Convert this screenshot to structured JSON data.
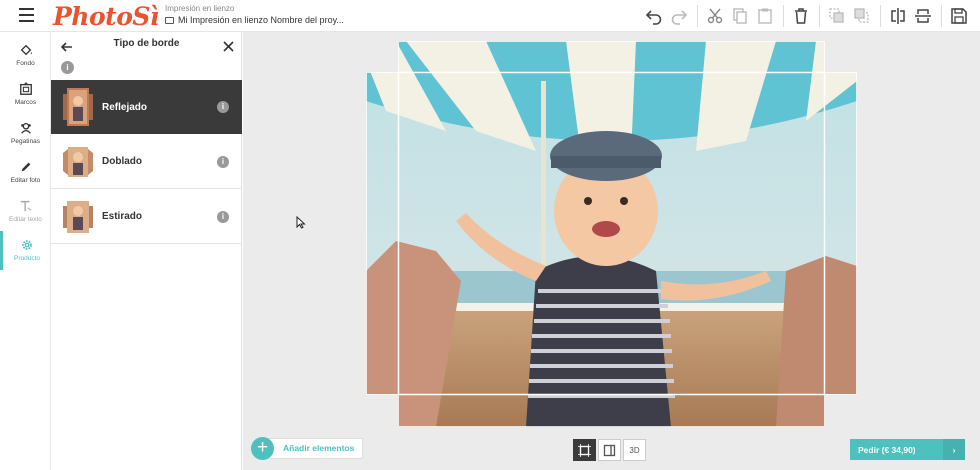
{
  "header": {
    "logo": "PhotoSì",
    "breadcrumb_top": "Impresión en lienzo",
    "breadcrumb_project": "Mi Impresión en lienzo Nombre del proy..."
  },
  "toolbar_icons": [
    "undo-icon",
    "redo-icon",
    "cut-icon",
    "copy-icon",
    "paste-icon",
    "delete-icon",
    "send-back-icon",
    "bring-front-icon",
    "flip-horizontal-icon",
    "flip-vertical-icon",
    "save-icon"
  ],
  "nav": {
    "items": [
      {
        "label": "Fondo",
        "icon": "fill-bucket-icon"
      },
      {
        "label": "Marcos",
        "icon": "frame-icon"
      },
      {
        "label": "Pegatinas",
        "icon": "sticker-icon"
      },
      {
        "label": "Editar foto",
        "icon": "pencil-icon"
      },
      {
        "label": "Editar texto",
        "icon": "text-icon"
      },
      {
        "label": "Producto",
        "icon": "gear-icon"
      }
    ]
  },
  "panel": {
    "title": "Tipo de borde",
    "info": "i",
    "options": [
      {
        "label": "Reflejado",
        "info": "i",
        "selected": true
      },
      {
        "label": "Doblado",
        "info": "i",
        "selected": false
      },
      {
        "label": "Estirado",
        "info": "i",
        "selected": false
      }
    ]
  },
  "footer": {
    "add_plus": "+",
    "add_label": "Añadir elementos",
    "view_3d": "3D",
    "order_label": "Pedir (€ 34,90)",
    "order_chevron": "›"
  },
  "colors": {
    "accent": "#4dc1be",
    "brand": "#e8542e",
    "selected_bg": "#3a3a3a"
  }
}
